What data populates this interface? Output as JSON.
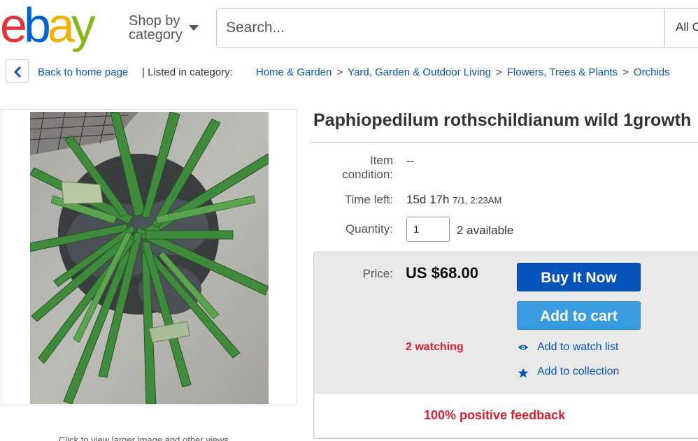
{
  "header": {
    "logo_text": "ebay",
    "shop_by_line1": "Shop by",
    "shop_by_line2": "category",
    "search_placeholder": "Search...",
    "all_categories": "All C"
  },
  "breadcrumb": {
    "back_label": "Back to home page",
    "listed_label": "| Listed in category:",
    "items": [
      "Home & Garden",
      "Yard, Garden & Outdoor Living",
      "Flowers, Trees & Plants",
      "Orchids"
    ],
    "separator": ">"
  },
  "image": {
    "caption": "Click to view larger image and other views"
  },
  "item": {
    "title": "Paphiopedilum rothschildianum wild 1growth",
    "condition_label_1": "Item",
    "condition_label_2": "condition:",
    "condition_value": "--",
    "time_left_label": "Time left:",
    "time_left_value": "15d 17h",
    "time_left_date": "7/1, 2:23AM",
    "quantity_label": "Quantity:",
    "quantity_value": "1",
    "available_text": "2 available"
  },
  "buybox": {
    "price_label": "Price:",
    "price_value": "US $68.00",
    "buy_now_label": "Buy It Now",
    "add_to_cart_label": "Add to cart",
    "watching_text": "2 watching",
    "watch_list_label": "Add to watch list",
    "collection_label": "Add to collection",
    "feedback_text": "100% positive feedback"
  },
  "colors": {
    "ebay_red": "#e53238",
    "ebay_blue": "#0064d2",
    "ebay_yellow": "#f5af02",
    "ebay_green": "#86b817",
    "link_blue": "#0654ba",
    "alert_red": "#dd1e31"
  }
}
